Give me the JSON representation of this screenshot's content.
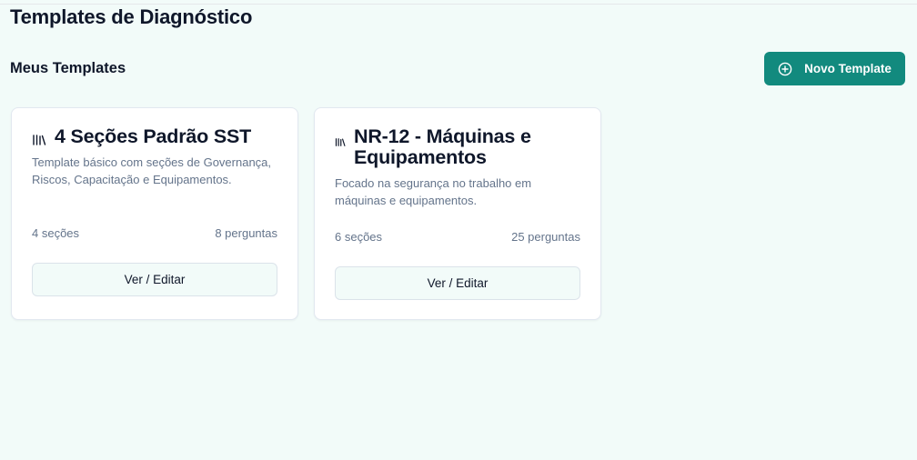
{
  "page": {
    "title": "Templates de Diagnóstico"
  },
  "section": {
    "title": "Meus Templates",
    "new_button_label": "Novo Template",
    "new_button_icon": "plus-circle-icon"
  },
  "colors": {
    "accent": "#128a7e",
    "background": "#f2fbf9"
  },
  "templates": [
    {
      "icon": "library-icon",
      "title": "4 Seções Padrão SST",
      "description": "Template básico com seções de Governança, Riscos, Capacitação e Equipamentos.",
      "sections": "4 seções",
      "questions": "8 perguntas",
      "action_label": "Ver / Editar"
    },
    {
      "icon": "library-icon",
      "title": "NR-12 - Máquinas e Equipamentos",
      "description": "Focado na segurança no trabalho em máquinas e equipamentos.",
      "sections": "6 seções",
      "questions": "25 perguntas",
      "action_label": "Ver / Editar"
    }
  ]
}
